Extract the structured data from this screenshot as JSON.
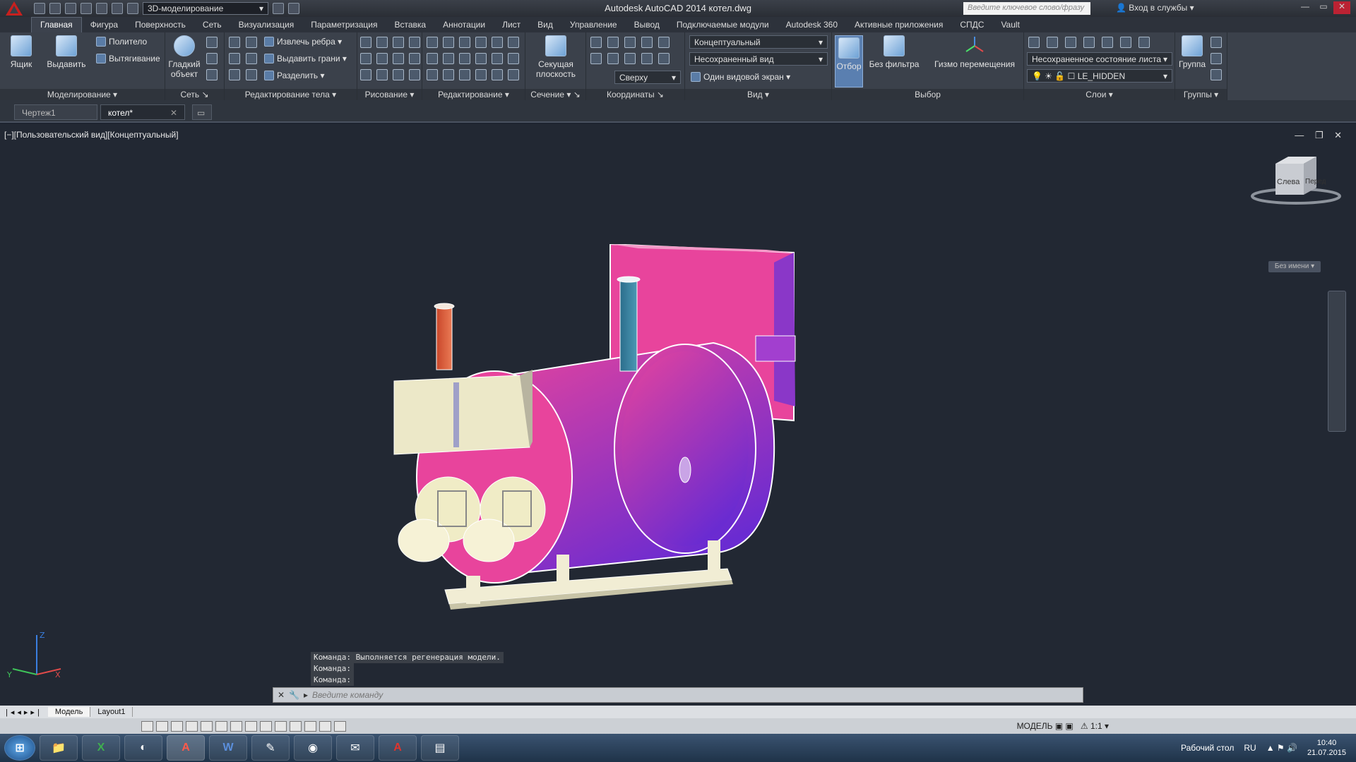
{
  "window": {
    "title": "Autodesk AutoCAD 2014    котел.dwg"
  },
  "qat": {
    "workspace": "3D-моделирование"
  },
  "search": {
    "placeholder": "Введите ключевое слово/фразу"
  },
  "signin": {
    "label": "Вход в службы"
  },
  "ribbon_tabs": [
    "Главная",
    "Фигура",
    "Поверхность",
    "Сеть",
    "Визуализация",
    "Параметризация",
    "Вставка",
    "Аннотации",
    "Лист",
    "Вид",
    "Управление",
    "Вывод",
    "Подключаемые модули",
    "Autodesk 360",
    "Активные приложения",
    "СПДС",
    "Vault"
  ],
  "panels": {
    "modeling": {
      "title": "Моделирование ▾",
      "box": "Ящик",
      "extrude": "Выдавить",
      "polysolid": "Политело",
      "presspull": "Вытягивание"
    },
    "mesh": {
      "title": "Сеть ↘",
      "smooth": "Гладкий объект"
    },
    "solid_edit": {
      "title": "Редактирование тела ▾",
      "extract": "Извлечь ребра ▾",
      "extrude_faces": "Выдавить грани ▾",
      "separate": "Разделить ▾"
    },
    "draw": {
      "title": "Рисование ▾"
    },
    "modify": {
      "title": "Редактирование ▾"
    },
    "section": {
      "title": "Сечение ▾ ↘",
      "plane": "Секущая плоскость"
    },
    "coordinates": {
      "title": "Координаты ↘",
      "view_top": "Сверху"
    },
    "view": {
      "title": "Вид ▾",
      "visual_style": "Концептуальный",
      "named_view": "Несохраненный вид",
      "viewport_config": "Один видовой экран ▾"
    },
    "selection": {
      "title": "Выбор",
      "culling": "Отбор",
      "nofilter": "Без фильтра",
      "gizmo": "Гизмо перемещения"
    },
    "layers": {
      "title": "Слои ▾",
      "state": "Несохраненное состояние листа",
      "layer": "LE_HIDDEN"
    },
    "groups": {
      "title": "Группы ▾",
      "group": "Группа"
    }
  },
  "doc_tabs": [
    "Чертеж1",
    "котел*"
  ],
  "viewport": {
    "label": "[−][Пользовательский вид][Концептуальный]",
    "viewcube_left": "Слева",
    "viewcube_front": "Перед",
    "unnamed": "Без имени"
  },
  "command": {
    "history": [
      "Команда:  Выполняется регенерация модели.",
      "Команда:",
      "Команда:"
    ],
    "placeholder": "Введите команду"
  },
  "layouts": [
    "Модель",
    "Layout1"
  ],
  "status": {
    "space": "МОДЕЛЬ",
    "scale": "1:1"
  },
  "taskbar": {
    "desktop": "Рабочий стол",
    "lang": "RU",
    "time": "10:40",
    "date": "21.07.2015"
  },
  "colors": {
    "boiler_top": "#e8449c",
    "boiler_bottom": "#6a2bd1",
    "burner": "#ece8c8"
  }
}
